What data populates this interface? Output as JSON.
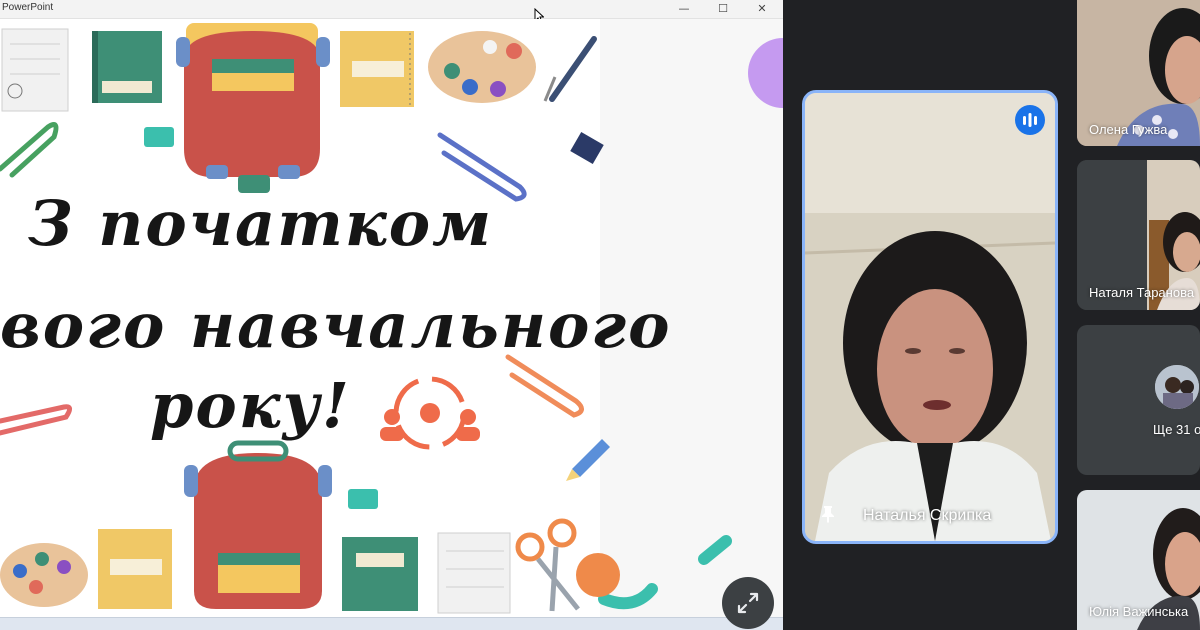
{
  "window": {
    "title": "PowerPoint",
    "controls": {
      "minimize": "—",
      "maximize": "☐",
      "close": "✕"
    }
  },
  "slide": {
    "title_lines": [
      "З початком",
      "вого навчального",
      "року!"
    ],
    "icons": [
      "backpack-icon",
      "notebook-icon",
      "paint-palette-icon",
      "compass-icon",
      "paperclip-icon",
      "sharpener-icon",
      "scissors-icon",
      "pencil-icon",
      "binder-clip-icon",
      "teamwork-cycle-icon"
    ]
  },
  "meet": {
    "main_participant": {
      "name": "Наталья Скрипка",
      "speaking": true
    },
    "participants": [
      {
        "name": "Олена Гужва"
      },
      {
        "name": "Наталя Таранова"
      },
      {
        "name": "Юлія Важинська"
      }
    ],
    "more_label": "Ще 31 о"
  },
  "colors": {
    "meet_background": "#202124",
    "active_speaker_border": "#8ab4f8",
    "speaking_badge": "#1a73e8",
    "slide_backpack": "#c9524a",
    "slide_accent_teal": "#3bbfad"
  }
}
